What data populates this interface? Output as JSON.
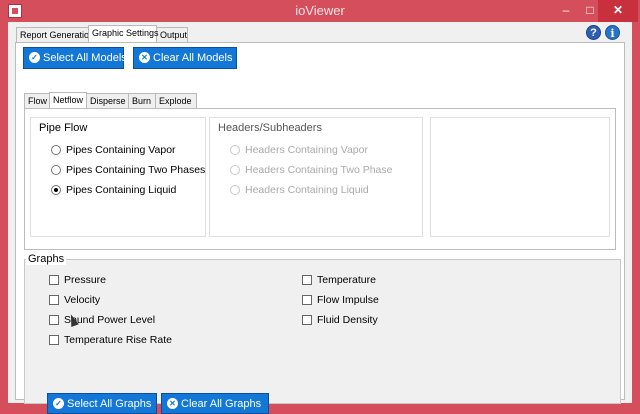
{
  "window": {
    "title": "ioViewer",
    "minimize": "–",
    "maximize": "□",
    "close": "✕"
  },
  "main_tabs": [
    "Report Generation",
    "Graphic Settings",
    "Output"
  ],
  "active_main_tab": "Graphic Settings",
  "header_icons": {
    "help": "?",
    "info": "i"
  },
  "model_buttons": {
    "select_all": "Select All Models",
    "clear_all": "Clear All Models"
  },
  "sub_tabs": [
    "Flow",
    "Netflow",
    "Disperse",
    "Burn",
    "Explode"
  ],
  "active_sub_tab": "Netflow",
  "pipe_flow": {
    "title": "Pipe Flow",
    "options": [
      "Pipes Containing Vapor",
      "Pipes Containing Two Phases",
      "Pipes Containing Liquid"
    ],
    "selected": "Pipes Containing Liquid"
  },
  "headers": {
    "title": "Headers/Subheaders",
    "options": [
      "Headers Containing Vapor",
      "Headers Containing Two Phase",
      "Headers Containing Liquid"
    ],
    "enabled": false
  },
  "graphs": {
    "title": "Graphs",
    "left": [
      "Pressure",
      "Velocity",
      "Sound Power Level",
      "Temperature Rise Rate"
    ],
    "right": [
      "Temperature",
      "Flow Impulse",
      "Fluid Density"
    ],
    "select_all": "Select All Graphs",
    "clear_all": "Clear All Graphs"
  },
  "colors": {
    "titlebar": "#d44e5b",
    "button": "#1277d6"
  }
}
